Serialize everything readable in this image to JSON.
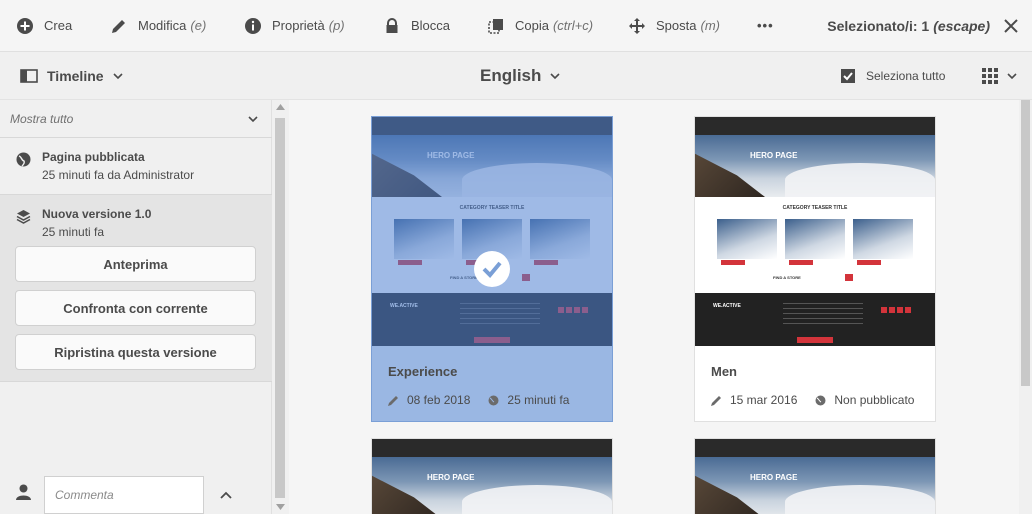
{
  "actions": {
    "create": "Crea",
    "edit": "Modifica",
    "edit_kb": "(e)",
    "properties": "Proprietà",
    "properties_kb": "(p)",
    "lock": "Blocca",
    "copy": "Copia",
    "copy_kb": "(ctrl+c)",
    "move": "Sposta",
    "move_kb": "(m)",
    "more": "•••",
    "selected_prefix": "Selezionato/i: 1",
    "selected_kb": "(escape)"
  },
  "subbar": {
    "rail_label": "Timeline",
    "language": "English",
    "select_all": "Seleziona tutto"
  },
  "timeline": {
    "filter": "Mostra tutto",
    "items": [
      {
        "title": "Pagina pubblicata",
        "sub": "25 minuti fa da Administrator",
        "icon": "globe-icon"
      },
      {
        "title": "Nuova versione 1.0",
        "sub": "25 minuti fa",
        "icon": "layers-icon"
      }
    ],
    "buttons": {
      "preview": "Anteprima",
      "compare": "Confronta con corrente",
      "restore": "Ripristina questa versione"
    },
    "comment_placeholder": "Commenta"
  },
  "thumbnail": {
    "hero": "HERO PAGE",
    "category": "CATEGORY TEASER TITLE",
    "find": "FIND A STORE",
    "footer_brand": "WE.ACTIVE"
  },
  "cards": [
    {
      "title": "Experience",
      "modified": "08 feb 2018",
      "published": "25 minuti fa",
      "selected": true
    },
    {
      "title": "Men",
      "modified": "15 mar 2016",
      "published": "Non pubblicato",
      "selected": false
    }
  ],
  "colors": {
    "selection": "#9ab7e3",
    "accent_red": "#d3343b",
    "background": "#f5f5f5"
  }
}
